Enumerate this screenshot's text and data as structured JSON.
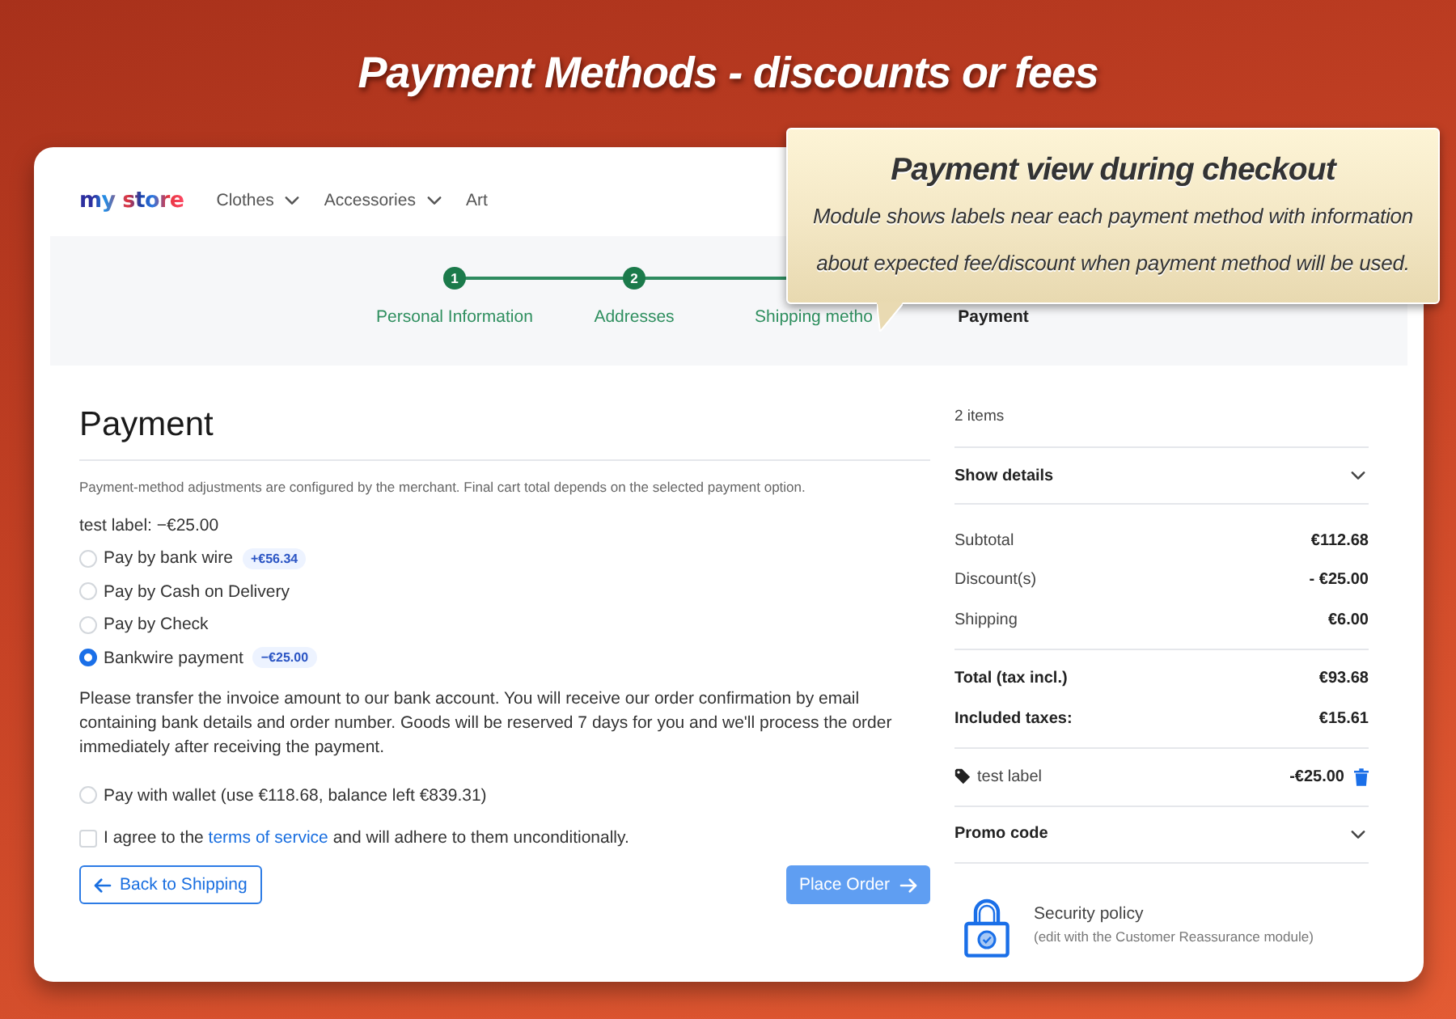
{
  "banner": {
    "title": "Payment Methods - discounts or fees"
  },
  "header": {
    "logo": "my store",
    "nav": [
      {
        "label": "Clothes",
        "has_dropdown": true
      },
      {
        "label": "Accessories",
        "has_dropdown": true
      },
      {
        "label": "Art",
        "has_dropdown": false
      }
    ]
  },
  "steps": [
    {
      "number": "1",
      "label": "Personal Information",
      "current": false
    },
    {
      "number": "2",
      "label": "Addresses",
      "current": false
    },
    {
      "label": "Shipping metho",
      "current": false
    },
    {
      "label": "Payment",
      "current": true
    }
  ],
  "callout": {
    "title": "Payment view during checkout",
    "text": "Module shows labels near each payment method with information about expected fee/discount when payment method will be used."
  },
  "payment": {
    "title": "Payment",
    "note": "Payment-method adjustments are configured by the merchant. Final cart total depends on the selected payment option.",
    "adjustment": "test label: −€25.00",
    "options": [
      {
        "label": "Pay by bank wire",
        "badge": "+€56.34",
        "selected": false
      },
      {
        "label": "Pay by Cash on Delivery",
        "selected": false
      },
      {
        "label": "Pay by Check",
        "selected": false
      },
      {
        "label": "Bankwire payment",
        "badge": "−€25.00",
        "selected": true,
        "details": "Please transfer the invoice amount to our bank account. You will receive our order confirmation by email containing bank details and order number. Goods will be reserved 7 days for you and we'll process the order immediately after receiving the payment."
      },
      {
        "label": "Pay with wallet (use €118.68, balance left €839.31)",
        "selected": false
      }
    ],
    "terms": {
      "checked": false,
      "before": "I agree to the ",
      "link": "terms of service",
      "after": " and will adhere to them unconditionally."
    },
    "back_button": {
      "label": "Back to Shipping"
    },
    "place_order_button": {
      "label": "Place Order",
      "disabled": true
    }
  },
  "summary": {
    "items_count": "2 items",
    "details_toggle": {
      "label": "Show details",
      "expanded": false
    },
    "lines": [
      {
        "label": "Subtotal",
        "value": "€112.68"
      },
      {
        "label": "Discount(s)",
        "value": "- €25.00"
      },
      {
        "label": "Shipping",
        "value": "€6.00"
      }
    ],
    "totals": [
      {
        "label": "Total (tax incl.)",
        "value": "€93.68"
      },
      {
        "label": "Included taxes:",
        "value": "€15.61"
      }
    ],
    "voucher": {
      "label": "test label",
      "value": "-€25.00"
    },
    "promo_toggle": {
      "label": "Promo code",
      "expanded": false
    },
    "reassurance": {
      "title": "Security policy",
      "text": "(edit with the Customer Reassurance module)"
    }
  }
}
